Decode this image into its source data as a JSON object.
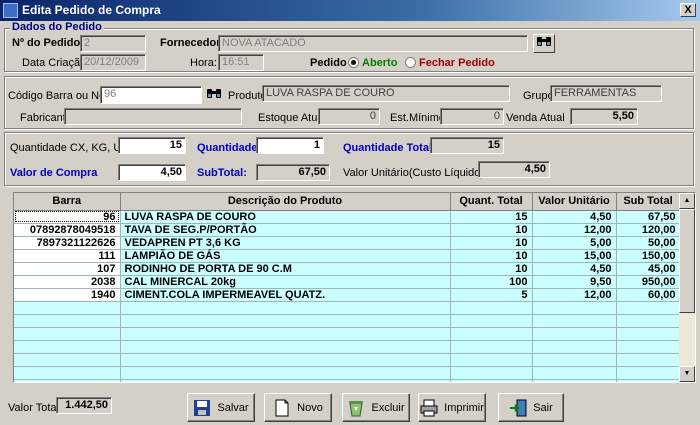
{
  "window": {
    "title": "Edita Pedido de Compra",
    "close_glyph": "X"
  },
  "pedido": {
    "group_title": "Dados do Pedido",
    "numero_label": "Nº do Pedido",
    "numero_value": "2",
    "fornecedor_label": "Fornecedor:",
    "fornecedor_value": "NOVA ATACADO",
    "data_label": "Data Criação",
    "data_value": "20/12/2009",
    "hora_label": "Hora:",
    "hora_value": "16:51",
    "pedido_label": "Pedido",
    "aberto_label": "Aberto",
    "fechar_label": "Fechar Pedido",
    "status_selected": "Aberto"
  },
  "produto": {
    "codigo_label": "Código Barra ou Nome",
    "codigo_value": "96",
    "produto_label": "Produto",
    "produto_value": "LUVA RASPA DE COURO",
    "grupo_label": "Grupo",
    "grupo_value": "FERRAMENTAS",
    "fabricante_label": "Fabricante",
    "fabricante_value": "",
    "estoque_label": "Estoque Atual",
    "estoque_value": "0",
    "estmin_label": "Est.Mínimo",
    "estmin_value": "0",
    "venda_label": "Venda Atual",
    "venda_value": "5,50"
  },
  "valores": {
    "qtd_cx_label": "Quantidade  CX, KG, UN...",
    "qtd_cx_value": "15",
    "quantidade_label": "Quantidade",
    "quantidade_value": "1",
    "qtd_total_label": "Quantidade Total",
    "qtd_total_value": "15",
    "valor_compra_label": "Valor de Compra",
    "valor_compra_value": "4,50",
    "subtotal_label": "SubTotal:",
    "subtotal_value": "67,50",
    "valor_unit_label": "Valor Unitário(Custo Líquido)",
    "valor_unit_value": "4,50"
  },
  "grid": {
    "columns": [
      "Barra",
      "Descrição do Produto",
      "Quant. Total",
      "Valor Unitário",
      "Sub Total"
    ],
    "rows": [
      [
        "96",
        "LUVA RASPA DE COURO",
        "15",
        "4,50",
        "67,50"
      ],
      [
        "07892878049518",
        "TAVA DE SEG.P/PORTÃO",
        "10",
        "12,00",
        "120,00"
      ],
      [
        "7897321122626",
        "VEDAPREN PT 3,6 KG",
        "10",
        "5,00",
        "50,00"
      ],
      [
        "111",
        "LAMPIÃO DE  GÁS",
        "10",
        "15,00",
        "150,00"
      ],
      [
        "107",
        "RODINHO DE PORTA DE 90 C.M",
        "10",
        "4,50",
        "45,00"
      ],
      [
        "2038",
        "CAL MINERCAL 20kg",
        "100",
        "9,50",
        "950,00"
      ],
      [
        "1940",
        "CIMENT.COLA IMPERMEAVEL  QUATZ.",
        "5",
        "12,00",
        "60,00"
      ]
    ]
  },
  "footer": {
    "total_label": "Valor Total",
    "total_value": "1.442,50"
  },
  "buttons": {
    "salvar": "Salvar",
    "novo": "Novo",
    "excluir": "Excluir",
    "imprimir": "Imprimir",
    "sair": "Sair"
  },
  "icons": [
    "app-icon",
    "binoculars-icon",
    "floppy-disk-icon",
    "new-document-icon",
    "recycle-bin-icon",
    "printer-icon",
    "exit-door-icon"
  ]
}
